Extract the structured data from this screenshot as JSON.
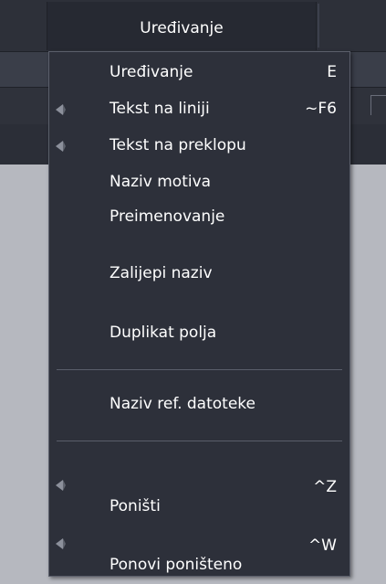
{
  "menubar": {
    "active_menu": "Uređivanje"
  },
  "menu": {
    "items": [
      {
        "label": "Uređivanje",
        "shortcut": "E",
        "submenu": false
      },
      {
        "label": "Tekst na liniji",
        "shortcut": "~F6",
        "submenu": true
      },
      {
        "label": "Tekst na preklopu",
        "shortcut": "",
        "submenu": true
      },
      {
        "label": "Naziv motiva",
        "shortcut": "",
        "submenu": false
      },
      {
        "label": "Preimenovanje",
        "shortcut": "",
        "submenu": false
      },
      {
        "label": "Zalijepi naziv",
        "shortcut": "",
        "submenu": false
      },
      {
        "label": "Duplikat polja",
        "shortcut": "",
        "submenu": false
      },
      {
        "label": "Naziv ref. datoteke",
        "shortcut": "",
        "submenu": false
      },
      {
        "label": "Poništi",
        "shortcut": "^Z",
        "submenu": true
      },
      {
        "label": "Ponovi poništeno",
        "shortcut": "^W",
        "submenu": true
      }
    ]
  },
  "colors": {
    "menu_bg": "#2d303a",
    "menu_border": "#5b5f6b",
    "text": "#ffffff",
    "canvas": "#b6b8bf"
  },
  "icons": {
    "submenu": "submenu-arrow-icon"
  }
}
